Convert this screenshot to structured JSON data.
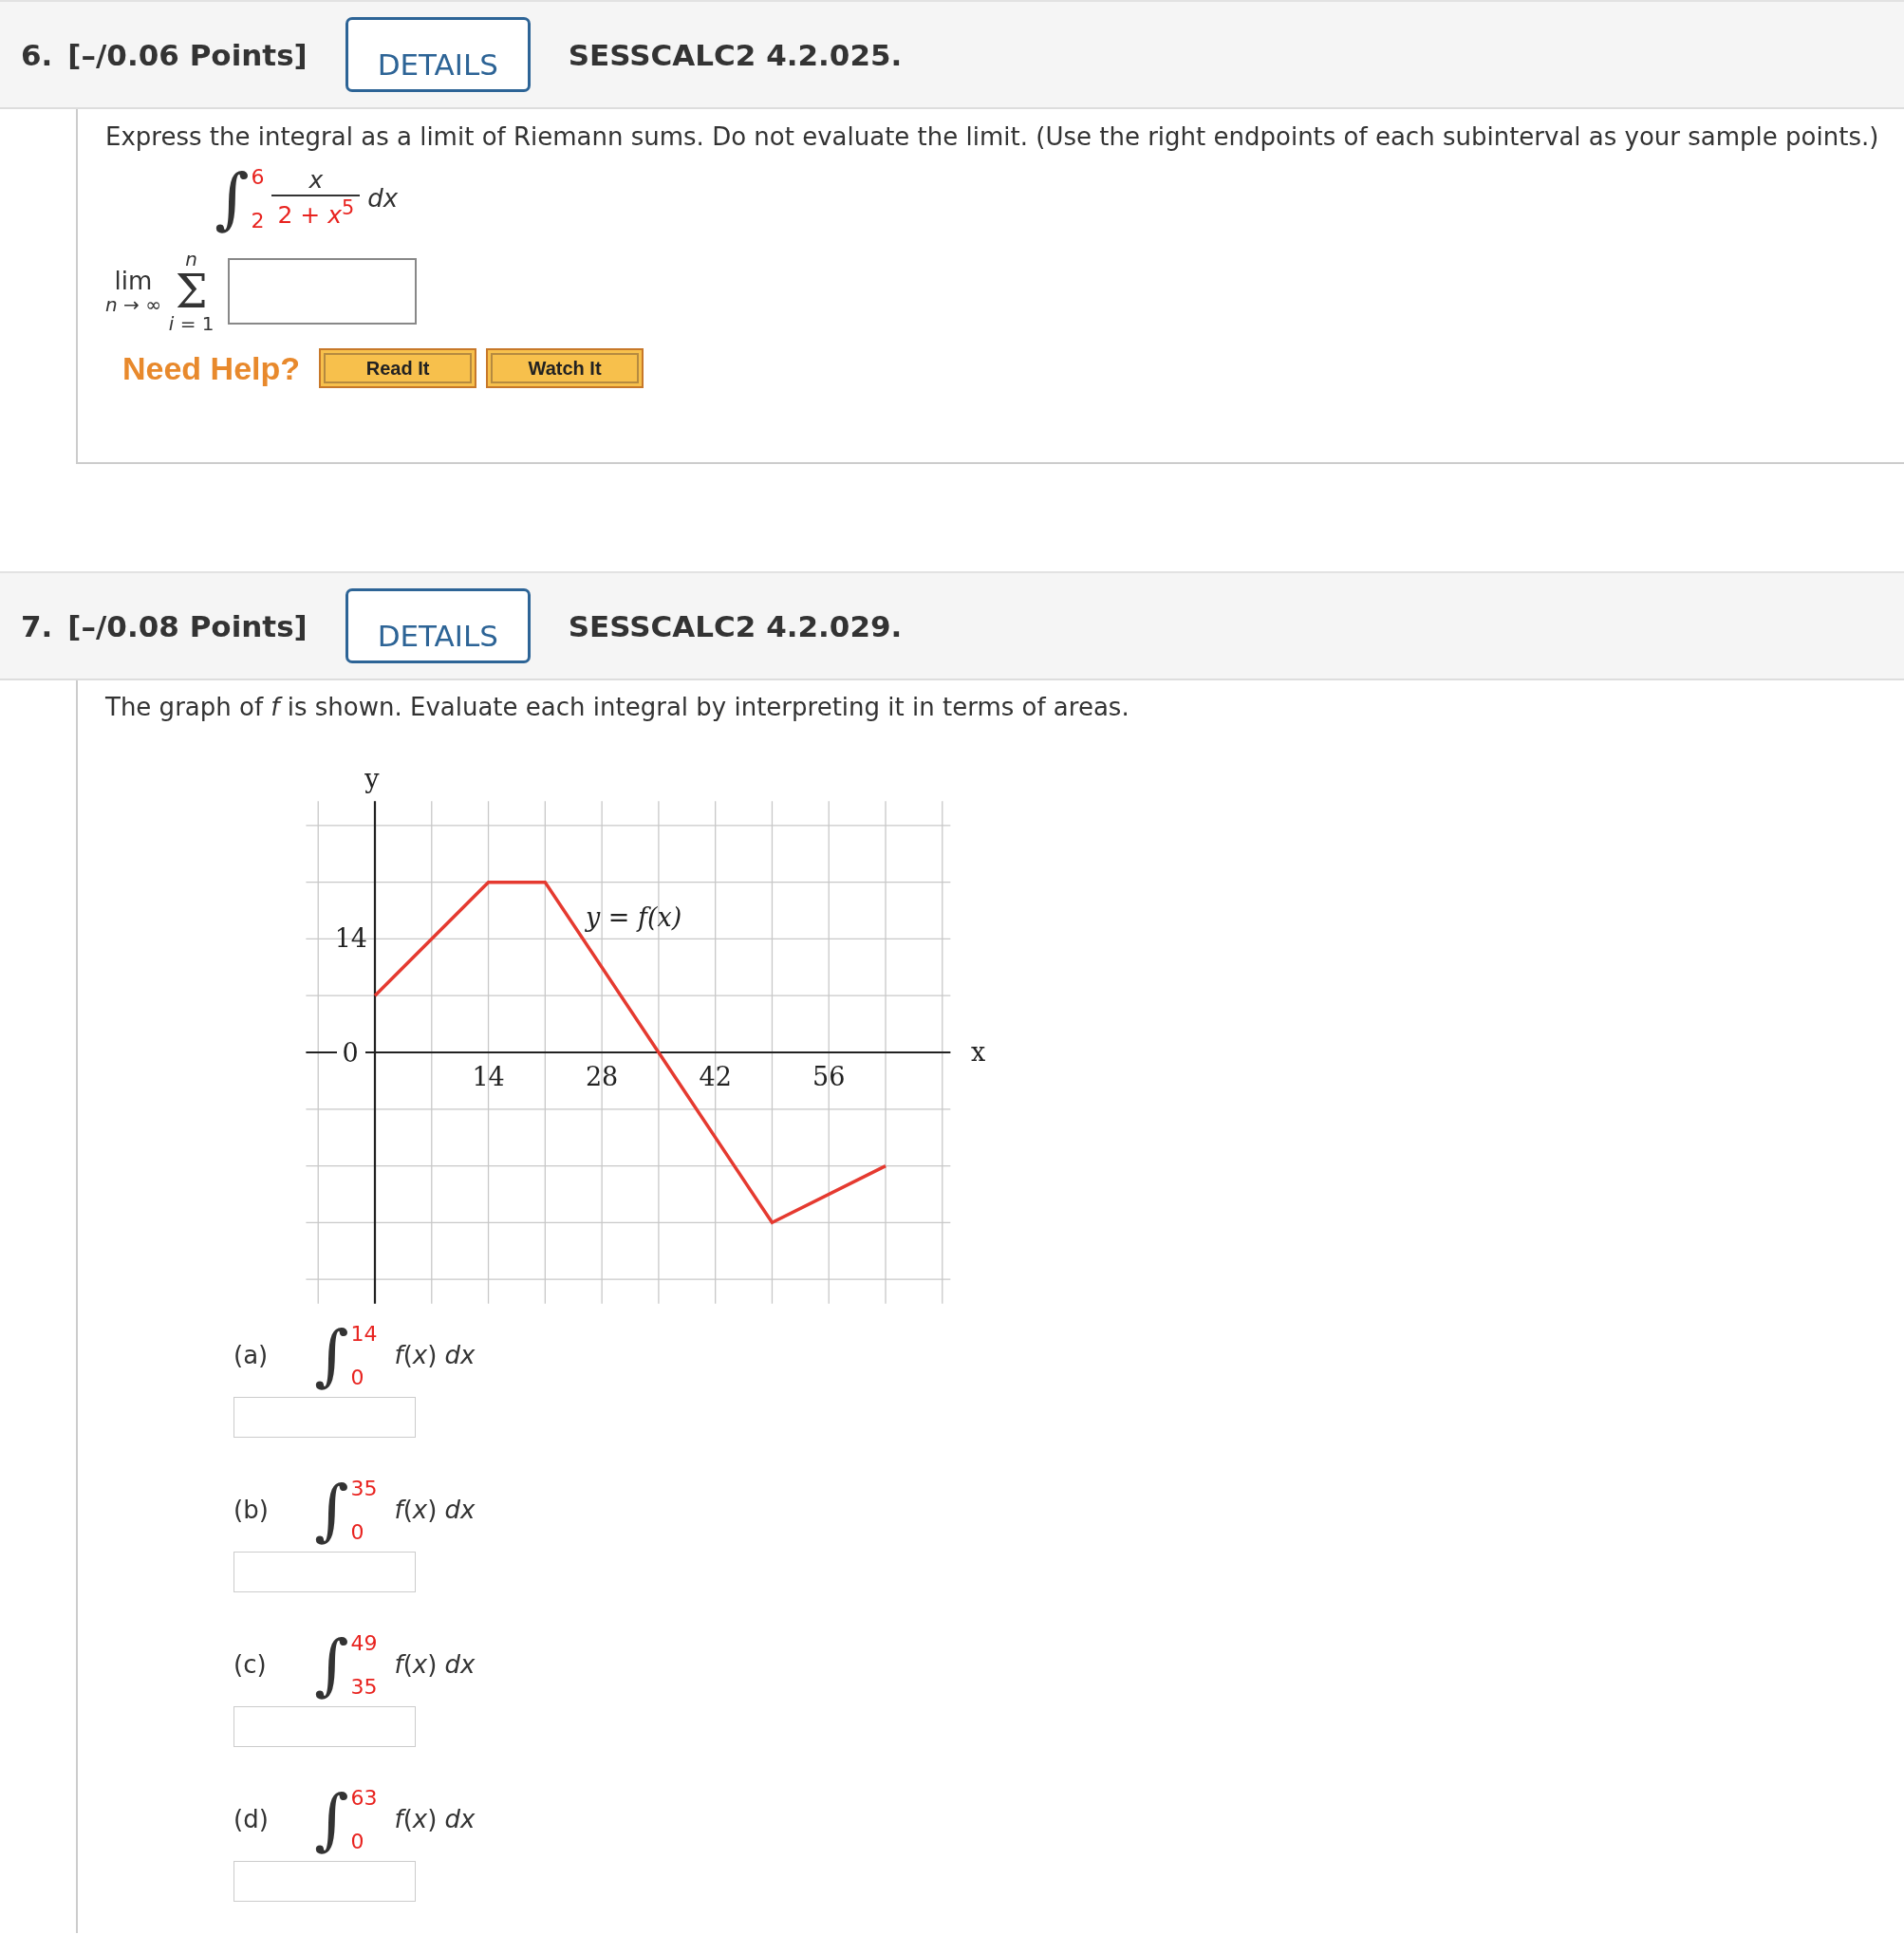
{
  "questions": [
    {
      "kind": "riemann",
      "number": "6.",
      "points": "[–/0.06 Points]",
      "details_button": "DETAILS",
      "source": "SESSCALC2 4.2.025.",
      "prompt": "Express the integral as a limit of Riemann sums. Do not evaluate the limit. (Use the right endpoints of each subinterval as your sample points.)",
      "integral": {
        "sign": "∫",
        "upper": "6",
        "lower": "2",
        "numerator": "*x*",
        "denominator": "2 + *x*$^{5}$",
        "differential": "*dx*"
      },
      "limit": {
        "lim": "lim",
        "under": "*n* → ∞",
        "sigma": "Σ",
        "sigma_upper": "*n*",
        "sigma_lower": "*i* = 1"
      },
      "help": {
        "label": "Need Help?",
        "buttons": [
          "Read It",
          "Watch It"
        ]
      }
    },
    {
      "kind": "graph",
      "number": "7.",
      "points": "[–/0.08 Points]",
      "details_button": "DETAILS",
      "source": "SESSCALC2 4.2.029.",
      "prompt": "The graph of *f* is shown. Evaluate each integral by interpreting it in terms of areas.",
      "chart_data": {
        "type": "line",
        "xlabel": "x",
        "ylabel": "y",
        "x": [
          0,
          14,
          21,
          35,
          49,
          63
        ],
        "series": [
          {
            "name": "y = f(x)",
            "color": "#e53a30",
            "values": [
              7,
              21,
              21,
              0,
              -21,
              -14
            ]
          }
        ],
        "xlim": [
          -8.5,
          71
        ],
        "ylim": [
          -31,
          31
        ],
        "xticks": [
          14,
          28,
          42,
          56
        ],
        "yticks": [
          {
            "value": 0,
            "label": "0"
          },
          14
        ],
        "grid": true
      },
      "parts": [
        {
          "label": "(a)",
          "sign": "∫",
          "upper": "14",
          "lower": "0",
          "integrand": "*f*(*x*) *dx*"
        },
        {
          "label": "(b)",
          "sign": "∫",
          "upper": "35",
          "lower": "0",
          "integrand": "*f*(*x*) *dx*"
        },
        {
          "label": "(c)",
          "sign": "∫",
          "upper": "49",
          "lower": "35",
          "integrand": "*f*(*x*) *dx*"
        },
        {
          "label": "(d)",
          "sign": "∫",
          "upper": "63",
          "lower": "0",
          "integrand": "*f*(*x*) *dx*"
        }
      ]
    }
  ]
}
